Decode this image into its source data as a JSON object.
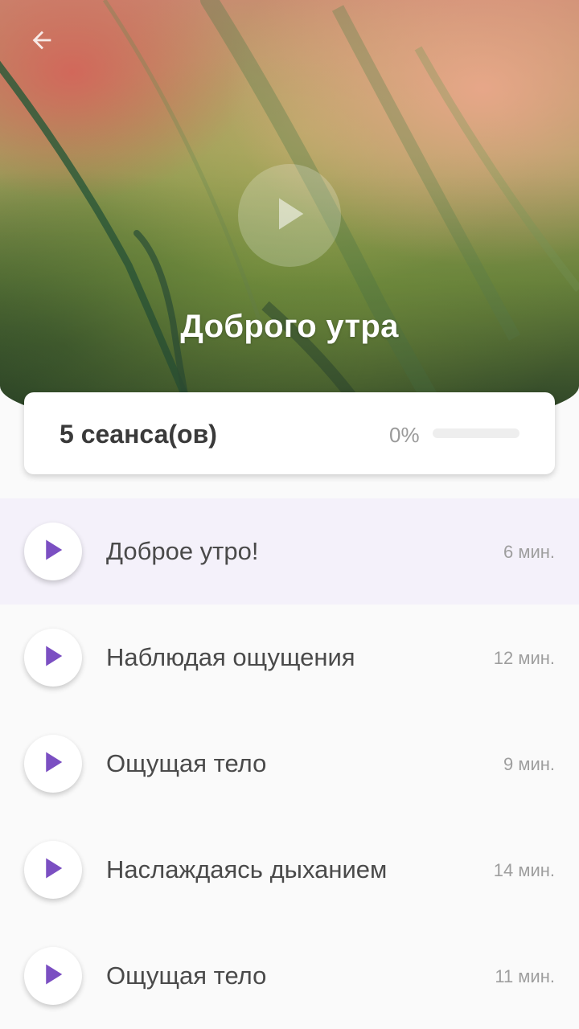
{
  "header": {
    "back_icon": "arrow-left-icon",
    "play_icon": "play-icon",
    "title": "Доброго утра"
  },
  "progress": {
    "sessions_label": "5 сеанса(ов)",
    "percent_label": "0%",
    "fraction": 0
  },
  "sessions": [
    {
      "title": "Доброе утро!",
      "duration": "6 мин.",
      "active": true
    },
    {
      "title": "Наблюдая ощущения",
      "duration": "12 мин.",
      "active": false
    },
    {
      "title": "Ощущая тело",
      "duration": "9 мин.",
      "active": false
    },
    {
      "title": "Наслаждаясь дыханием",
      "duration": "14 мин.",
      "active": false
    },
    {
      "title": "Ощущая тело",
      "duration": "11 мин.",
      "active": false
    }
  ],
  "colors": {
    "accent": "#7b4fc2",
    "active_row": "#f4f1fa"
  }
}
